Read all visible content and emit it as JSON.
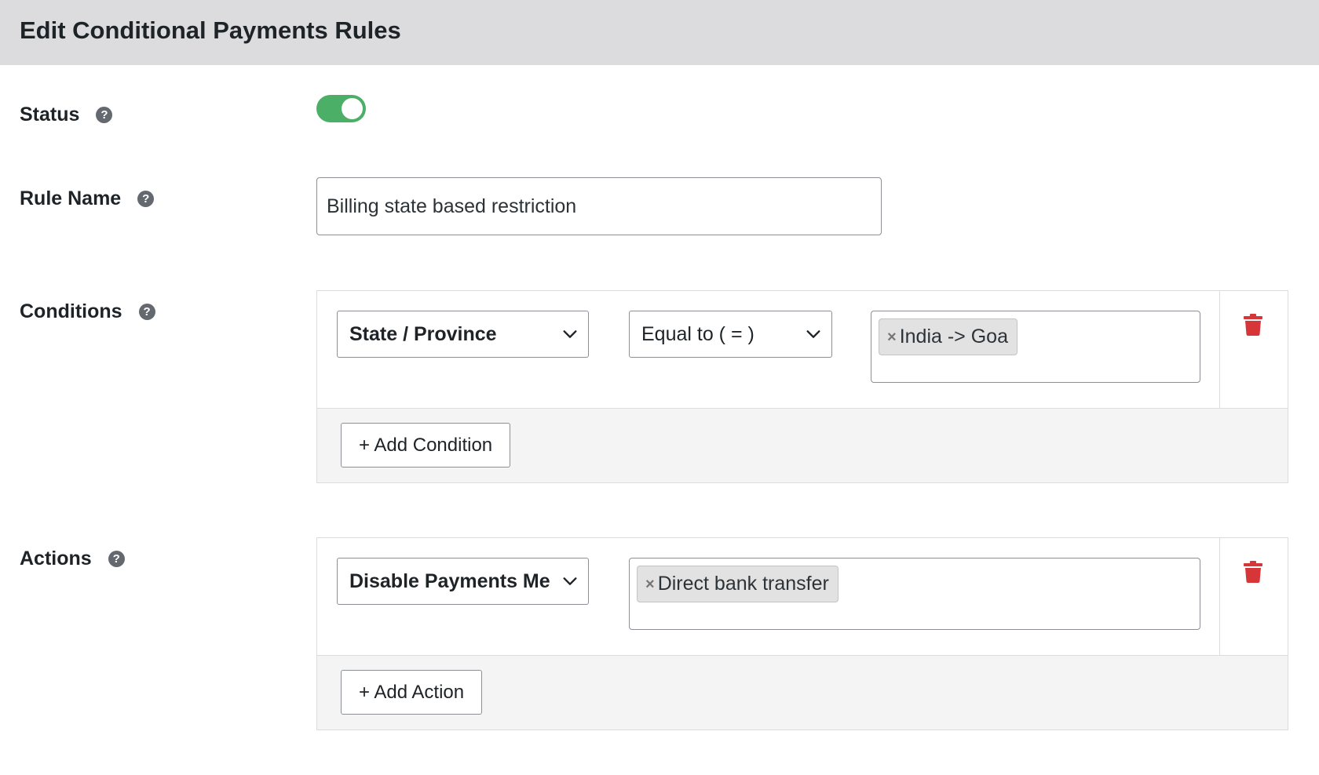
{
  "header": {
    "title": "Edit Conditional Payments Rules"
  },
  "help_glyph": "?",
  "status": {
    "label": "Status",
    "enabled": true,
    "toggle_color": "#4caf67"
  },
  "rule_name": {
    "label": "Rule Name",
    "value": "Billing state based restriction"
  },
  "conditions": {
    "label": "Conditions",
    "items": [
      {
        "field": "State / Province",
        "operator": "Equal to ( = )",
        "values": [
          "India -> Goa"
        ]
      }
    ],
    "add_label": "+ Add Condition"
  },
  "actions": {
    "label": "Actions",
    "items": [
      {
        "action": "Disable Payments Me",
        "values": [
          "Direct bank transfer"
        ]
      }
    ],
    "add_label": "+ Add Action"
  },
  "chip_remove_glyph": "×",
  "colors": {
    "delete": "#d63638",
    "header_bg": "#dcdcde",
    "help_icon": "#646970"
  }
}
